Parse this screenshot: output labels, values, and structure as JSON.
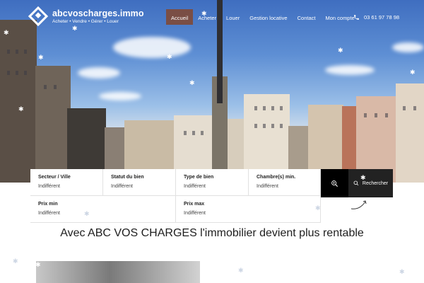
{
  "brand": {
    "name": "abcvoscharges.immo",
    "tagline": "Acheter • Vendre • Gérer • Louer"
  },
  "nav": {
    "items": [
      {
        "label": "Accueil",
        "active": true
      },
      {
        "label": "Acheter",
        "active": false
      },
      {
        "label": "Louer",
        "active": false
      },
      {
        "label": "Gestion locative",
        "active": false
      },
      {
        "label": "Contact",
        "active": false
      },
      {
        "label": "Mon compte",
        "active": false
      }
    ],
    "phone": "03 61 97 78 98"
  },
  "search": {
    "fields": [
      {
        "label": "Secteur / Ville",
        "value": "Indifférent"
      },
      {
        "label": "Statut du bien",
        "value": "Indifférent"
      },
      {
        "label": "Type de bien",
        "value": "Indifférent"
      },
      {
        "label": "Chambre(s) min.",
        "value": "Indifférent"
      },
      {
        "label": "Prix min",
        "value": "Indifférent"
      },
      {
        "label": "Prix max",
        "value": "Indifférent"
      }
    ],
    "submit_label": "Rechercher"
  },
  "main": {
    "headline": "Avec ABC VOS CHARGES l'immobilier devient plus rentable"
  },
  "colors": {
    "nav_active": "#7a4e45",
    "search_button": "#222222",
    "geo_button": "#000000"
  },
  "icons": [
    "logo-diamond-icon",
    "phone-icon",
    "location-zoom-icon",
    "search-icon",
    "curved-arrow-icon",
    "snowflake-icon"
  ]
}
